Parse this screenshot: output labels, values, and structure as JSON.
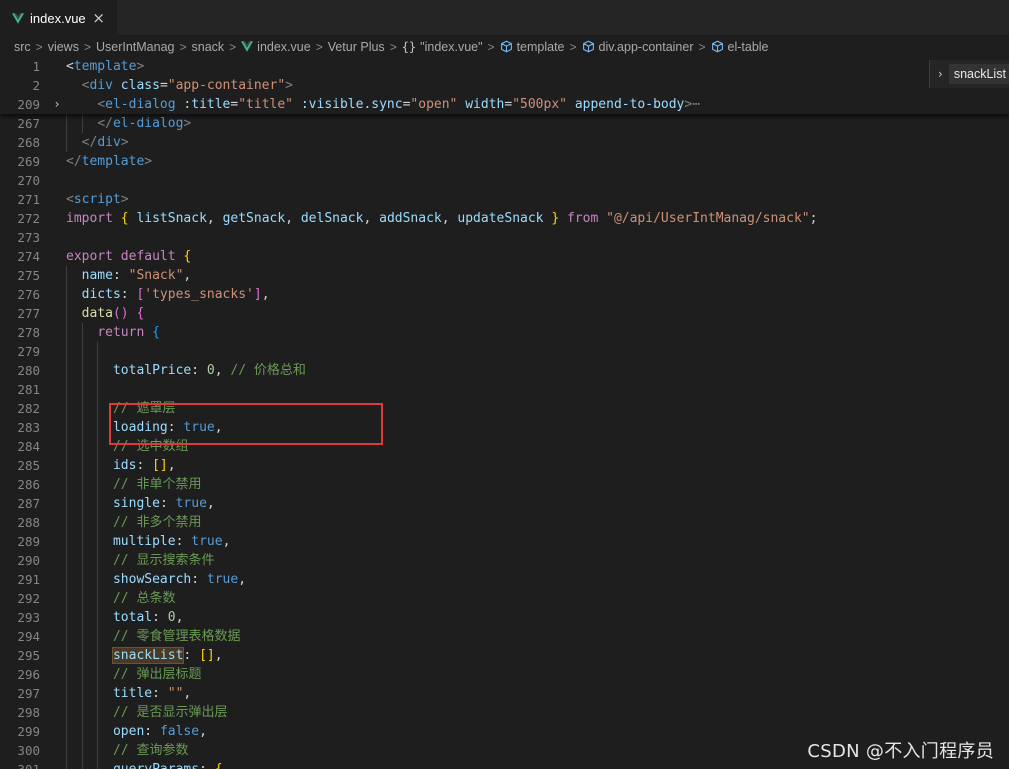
{
  "tab": {
    "label": "index.vue",
    "close": "×"
  },
  "breadcrumb": {
    "items": [
      "src",
      "views",
      "UserIntManag",
      "snack",
      "index.vue",
      "Vetur Plus",
      "\"index.vue\"",
      "template",
      "div.app-container",
      "el-table"
    ],
    "separator": ">",
    "braces": "{}"
  },
  "outline": {
    "label": "snackList"
  },
  "watermark": "CSDN @不入门程序员",
  "fold_collapsed_marker": "⋯",
  "colors": {
    "keyword": "#c586c0",
    "storage": "#569cd6",
    "tag": "#569cd6",
    "attr": "#9cdcfe",
    "string": "#ce9178",
    "function": "#dcdcaa",
    "number": "#b5cea8",
    "comment": "#6a9955",
    "punct": "#808080",
    "bracket1": "#ffd700",
    "bracket2": "#da70d6",
    "bracket3": "#179fff",
    "highlight_box": "#e0383b"
  },
  "sticky_lines": [
    {
      "num": "1",
      "tokens": [
        [
          "",
          "<"
        ],
        [
          "tag",
          "template"
        ],
        [
          "punct",
          ">"
        ]
      ]
    },
    {
      "num": "2",
      "tokens": [
        [
          "",
          "  "
        ],
        [
          "punct",
          "<"
        ],
        [
          "tag",
          "div "
        ],
        [
          "attr",
          "class"
        ],
        [
          "",
          "="
        ],
        [
          "string",
          "\"app-container\""
        ],
        [
          "punct",
          ">"
        ]
      ]
    },
    {
      "num": "209",
      "fold": "›",
      "tokens": [
        [
          "",
          "    "
        ],
        [
          "punct",
          "<"
        ],
        [
          "tag",
          "el-dialog "
        ],
        [
          "attr",
          ":title"
        ],
        [
          "",
          "="
        ],
        [
          "string",
          "\"title\" "
        ],
        [
          "attr",
          ":visible.sync"
        ],
        [
          "",
          "="
        ],
        [
          "string",
          "\"open\" "
        ],
        [
          "attr",
          "width"
        ],
        [
          "",
          "="
        ],
        [
          "string",
          "\"500px\" "
        ],
        [
          "attr",
          "append-to-body"
        ],
        [
          "punct",
          ">"
        ],
        [
          "punct",
          "⋯"
        ]
      ]
    }
  ],
  "lines": [
    {
      "num": "267",
      "tokens": [
        [
          "",
          "    "
        ],
        [
          "punct",
          "</"
        ],
        [
          "tag",
          "el-dialog"
        ],
        [
          "punct",
          ">"
        ]
      ]
    },
    {
      "num": "268",
      "tokens": [
        [
          "",
          "  "
        ],
        [
          "punct",
          "</"
        ],
        [
          "tag",
          "div"
        ],
        [
          "punct",
          ">"
        ]
      ]
    },
    {
      "num": "269",
      "tokens": [
        [
          "punct",
          "</"
        ],
        [
          "tag",
          "template"
        ],
        [
          "punct",
          ">"
        ]
      ]
    },
    {
      "num": "270",
      "tokens": []
    },
    {
      "num": "271",
      "tokens": [
        [
          "punct",
          "<"
        ],
        [
          "tag",
          "script"
        ],
        [
          "punct",
          ">"
        ]
      ]
    },
    {
      "num": "272",
      "tokens": [
        [
          "keyword",
          "import "
        ],
        [
          "bracket1",
          "{ "
        ],
        [
          "attr",
          "listSnack"
        ],
        [
          "",
          ", "
        ],
        [
          "attr",
          "getSnack"
        ],
        [
          "",
          ", "
        ],
        [
          "attr",
          "delSnack"
        ],
        [
          "",
          ", "
        ],
        [
          "attr",
          "addSnack"
        ],
        [
          "",
          ", "
        ],
        [
          "attr",
          "updateSnack "
        ],
        [
          "bracket1",
          "} "
        ],
        [
          "keyword",
          "from "
        ],
        [
          "string",
          "\"@/api/UserIntManag/snack\""
        ],
        [
          "",
          ";"
        ]
      ]
    },
    {
      "num": "273",
      "tokens": []
    },
    {
      "num": "274",
      "tokens": [
        [
          "keyword",
          "export default "
        ],
        [
          "bracket1",
          "{"
        ]
      ]
    },
    {
      "num": "275",
      "tokens": [
        [
          "",
          "  "
        ],
        [
          "attr",
          "name"
        ],
        [
          "",
          ": "
        ],
        [
          "string",
          "\"Snack\""
        ],
        [
          "",
          ","
        ]
      ]
    },
    {
      "num": "276",
      "tokens": [
        [
          "",
          "  "
        ],
        [
          "attr",
          "dicts"
        ],
        [
          "",
          ": "
        ],
        [
          "bracket2",
          "["
        ],
        [
          "string",
          "'types_snacks'"
        ],
        [
          "bracket2",
          "]"
        ],
        [
          "",
          ","
        ]
      ]
    },
    {
      "num": "277",
      "tokens": [
        [
          "",
          "  "
        ],
        [
          "function",
          "data"
        ],
        [
          "bracket2",
          "() {"
        ]
      ]
    },
    {
      "num": "278",
      "tokens": [
        [
          "",
          "    "
        ],
        [
          "keyword",
          "return "
        ],
        [
          "bracket3",
          "{"
        ]
      ]
    },
    {
      "num": "279",
      "tokens": []
    },
    {
      "num": "280",
      "tokens": [
        [
          "",
          "      "
        ],
        [
          "attr",
          "totalPrice"
        ],
        [
          "",
          ": "
        ],
        [
          "number",
          "0"
        ],
        [
          "",
          ", "
        ],
        [
          "comment",
          "// 价格总和"
        ]
      ]
    },
    {
      "num": "281",
      "tokens": []
    },
    {
      "num": "282",
      "tokens": [
        [
          "",
          "      "
        ],
        [
          "comment",
          "// 遮罩层"
        ]
      ]
    },
    {
      "num": "283",
      "tokens": [
        [
          "",
          "      "
        ],
        [
          "attr",
          "loading"
        ],
        [
          "",
          ": "
        ],
        [
          "storage",
          "true"
        ],
        [
          "",
          ","
        ]
      ]
    },
    {
      "num": "284",
      "tokens": [
        [
          "",
          "      "
        ],
        [
          "comment",
          "// 选中数组"
        ]
      ]
    },
    {
      "num": "285",
      "tokens": [
        [
          "",
          "      "
        ],
        [
          "attr",
          "ids"
        ],
        [
          "",
          ": "
        ],
        [
          "bracket1",
          "[]"
        ],
        [
          "",
          ","
        ]
      ]
    },
    {
      "num": "286",
      "tokens": [
        [
          "",
          "      "
        ],
        [
          "comment",
          "// 非单个禁用"
        ]
      ]
    },
    {
      "num": "287",
      "tokens": [
        [
          "",
          "      "
        ],
        [
          "attr",
          "single"
        ],
        [
          "",
          ": "
        ],
        [
          "storage",
          "true"
        ],
        [
          "",
          ","
        ]
      ]
    },
    {
      "num": "288",
      "tokens": [
        [
          "",
          "      "
        ],
        [
          "comment",
          "// 非多个禁用"
        ]
      ]
    },
    {
      "num": "289",
      "tokens": [
        [
          "",
          "      "
        ],
        [
          "attr",
          "multiple"
        ],
        [
          "",
          ": "
        ],
        [
          "storage",
          "true"
        ],
        [
          "",
          ","
        ]
      ]
    },
    {
      "num": "290",
      "tokens": [
        [
          "",
          "      "
        ],
        [
          "comment",
          "// 显示搜索条件"
        ]
      ]
    },
    {
      "num": "291",
      "tokens": [
        [
          "",
          "      "
        ],
        [
          "attr",
          "showSearch"
        ],
        [
          "",
          ": "
        ],
        [
          "storage",
          "true"
        ],
        [
          "",
          ","
        ]
      ]
    },
    {
      "num": "292",
      "tokens": [
        [
          "",
          "      "
        ],
        [
          "comment",
          "// 总条数"
        ]
      ]
    },
    {
      "num": "293",
      "tokens": [
        [
          "",
          "      "
        ],
        [
          "attr",
          "total"
        ],
        [
          "",
          ": "
        ],
        [
          "number",
          "0"
        ],
        [
          "",
          ","
        ]
      ]
    },
    {
      "num": "294",
      "tokens": [
        [
          "",
          "      "
        ],
        [
          "comment",
          "// 零食管理表格数据"
        ]
      ]
    },
    {
      "num": "295",
      "tokens": [
        [
          "",
          "      "
        ],
        [
          "attr-hl",
          "snackList"
        ],
        [
          "",
          ": "
        ],
        [
          "bracket1",
          "[]"
        ],
        [
          "",
          ","
        ]
      ]
    },
    {
      "num": "296",
      "tokens": [
        [
          "",
          "      "
        ],
        [
          "comment",
          "// 弹出层标题"
        ]
      ]
    },
    {
      "num": "297",
      "tokens": [
        [
          "",
          "      "
        ],
        [
          "attr",
          "title"
        ],
        [
          "",
          ": "
        ],
        [
          "string",
          "\"\""
        ],
        [
          "",
          ","
        ]
      ]
    },
    {
      "num": "298",
      "tokens": [
        [
          "",
          "      "
        ],
        [
          "comment",
          "// 是否显示弹出层"
        ]
      ]
    },
    {
      "num": "299",
      "tokens": [
        [
          "",
          "      "
        ],
        [
          "attr",
          "open"
        ],
        [
          "",
          ": "
        ],
        [
          "storage",
          "false"
        ],
        [
          "",
          ","
        ]
      ]
    },
    {
      "num": "300",
      "tokens": [
        [
          "",
          "      "
        ],
        [
          "comment",
          "// 查询参数"
        ]
      ]
    },
    {
      "num": "301",
      "tokens": [
        [
          "",
          "      "
        ],
        [
          "attr",
          "queryParams"
        ],
        [
          "",
          ": "
        ],
        [
          "bracket1",
          "{"
        ]
      ]
    }
  ]
}
